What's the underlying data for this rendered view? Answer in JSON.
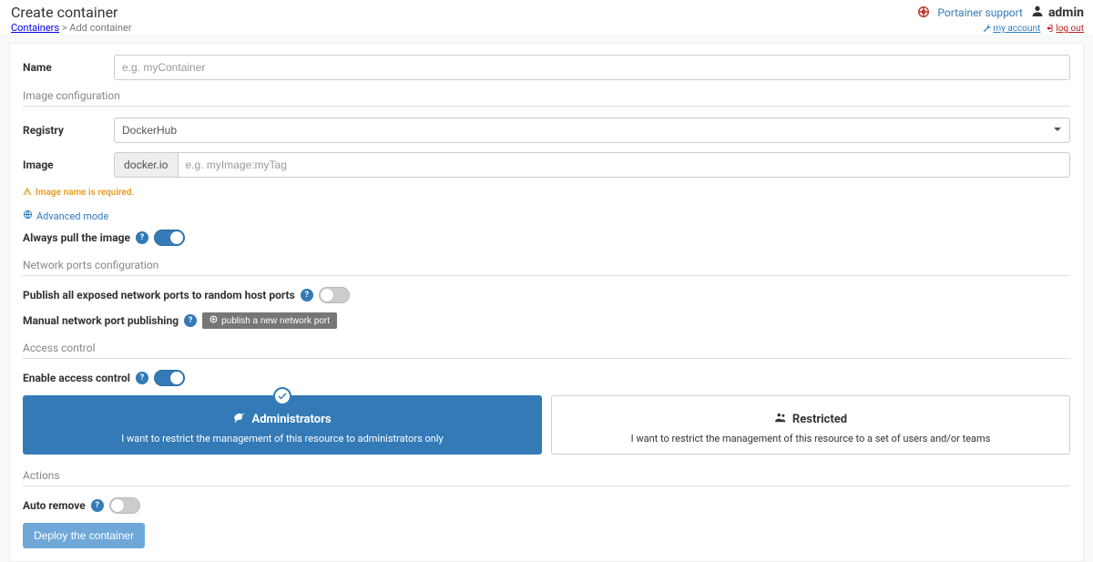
{
  "header": {
    "page_title": "Create container",
    "breadcrumb_link": "Containers",
    "breadcrumb_current": "Add container",
    "support_link": "Portainer support",
    "user_name": "admin",
    "my_account": "my account",
    "logout": "log out"
  },
  "form": {
    "name_label": "Name",
    "name_placeholder": "e.g. myContainer",
    "name_value": ""
  },
  "image_cfg": {
    "section": "Image configuration",
    "registry_label": "Registry",
    "registry_value": "DockerHub",
    "image_label": "Image",
    "image_prefix": "docker.io",
    "image_placeholder": "e.g. myImage:myTag",
    "image_value": "",
    "warn": "Image name is required.",
    "advanced": "Advanced mode",
    "always_pull_label": "Always pull the image"
  },
  "net": {
    "section": "Network ports configuration",
    "publish_all_label": "Publish all exposed network ports to random host ports",
    "manual_label": "Manual network port publishing",
    "publish_btn": "publish a new network port"
  },
  "access": {
    "section": "Access control",
    "enable_label": "Enable access control",
    "card_admin_title": "Administrators",
    "card_admin_desc": "I want to restrict the management of this resource to administrators only",
    "card_restricted_title": "Restricted",
    "card_restricted_desc": "I want to restrict the management of this resource to a set of users and/or teams"
  },
  "actions": {
    "section": "Actions",
    "auto_remove_label": "Auto remove",
    "deploy_label": "Deploy the container"
  }
}
